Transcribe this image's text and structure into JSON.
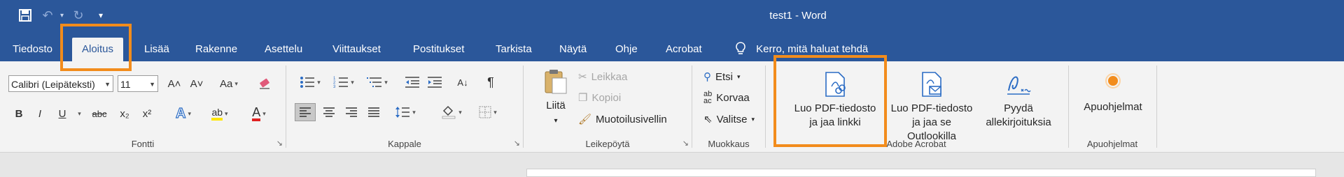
{
  "window": {
    "title": "test1  -  Word"
  },
  "qat": {
    "save": "▣",
    "undo": "↶",
    "redo": "↻",
    "customize": "▾"
  },
  "tabs": [
    "Tiedosto",
    "Aloitus",
    "Lisää",
    "Rakenne",
    "Asettelu",
    "Viittaukset",
    "Postitukset",
    "Tarkista",
    "Näytä",
    "Ohje",
    "Acrobat"
  ],
  "tell_me": "Kerro, mitä haluat tehdä",
  "font": {
    "name": "Calibri (Leipäteksti)",
    "size": "11",
    "grow": "A˄",
    "shrink": "A˅",
    "case": "Aa",
    "bold": "B",
    "italic": "I",
    "underline": "U",
    "strike": "abc",
    "sub": "x₂",
    "sup": "x²",
    "effects": "A",
    "highlight": "ab",
    "color": "A",
    "label": "Fontti"
  },
  "paragraph": {
    "label": "Kappale",
    "pilcrow": "¶",
    "sort": "A↓"
  },
  "clipboard": {
    "label": "Leikepöytä",
    "paste": "Liitä",
    "cut": "Leikkaa",
    "copy": "Kopioi",
    "painter": "Muotoilusivellin"
  },
  "editing": {
    "label": "Muokkaus",
    "find": "Etsi",
    "replace": "Korvaa",
    "select": "Valitse"
  },
  "acrobat": {
    "label": "Adobe Acrobat",
    "create_link_1": "Luo PDF-tiedosto",
    "create_link_2": "ja jaa linkki",
    "outlook_1": "Luo PDF-tiedosto",
    "outlook_2": "ja jaa se Outlookilla",
    "sign_1": "Pyydä",
    "sign_2": "allekirjoituksia"
  },
  "addins": {
    "label": "Apuohjelmat",
    "button": "Apuohjelmat"
  },
  "colors": {
    "brand": "#2b579a",
    "highlight_box": "#f28c1c",
    "accent_blue": "#2b6cc4"
  }
}
